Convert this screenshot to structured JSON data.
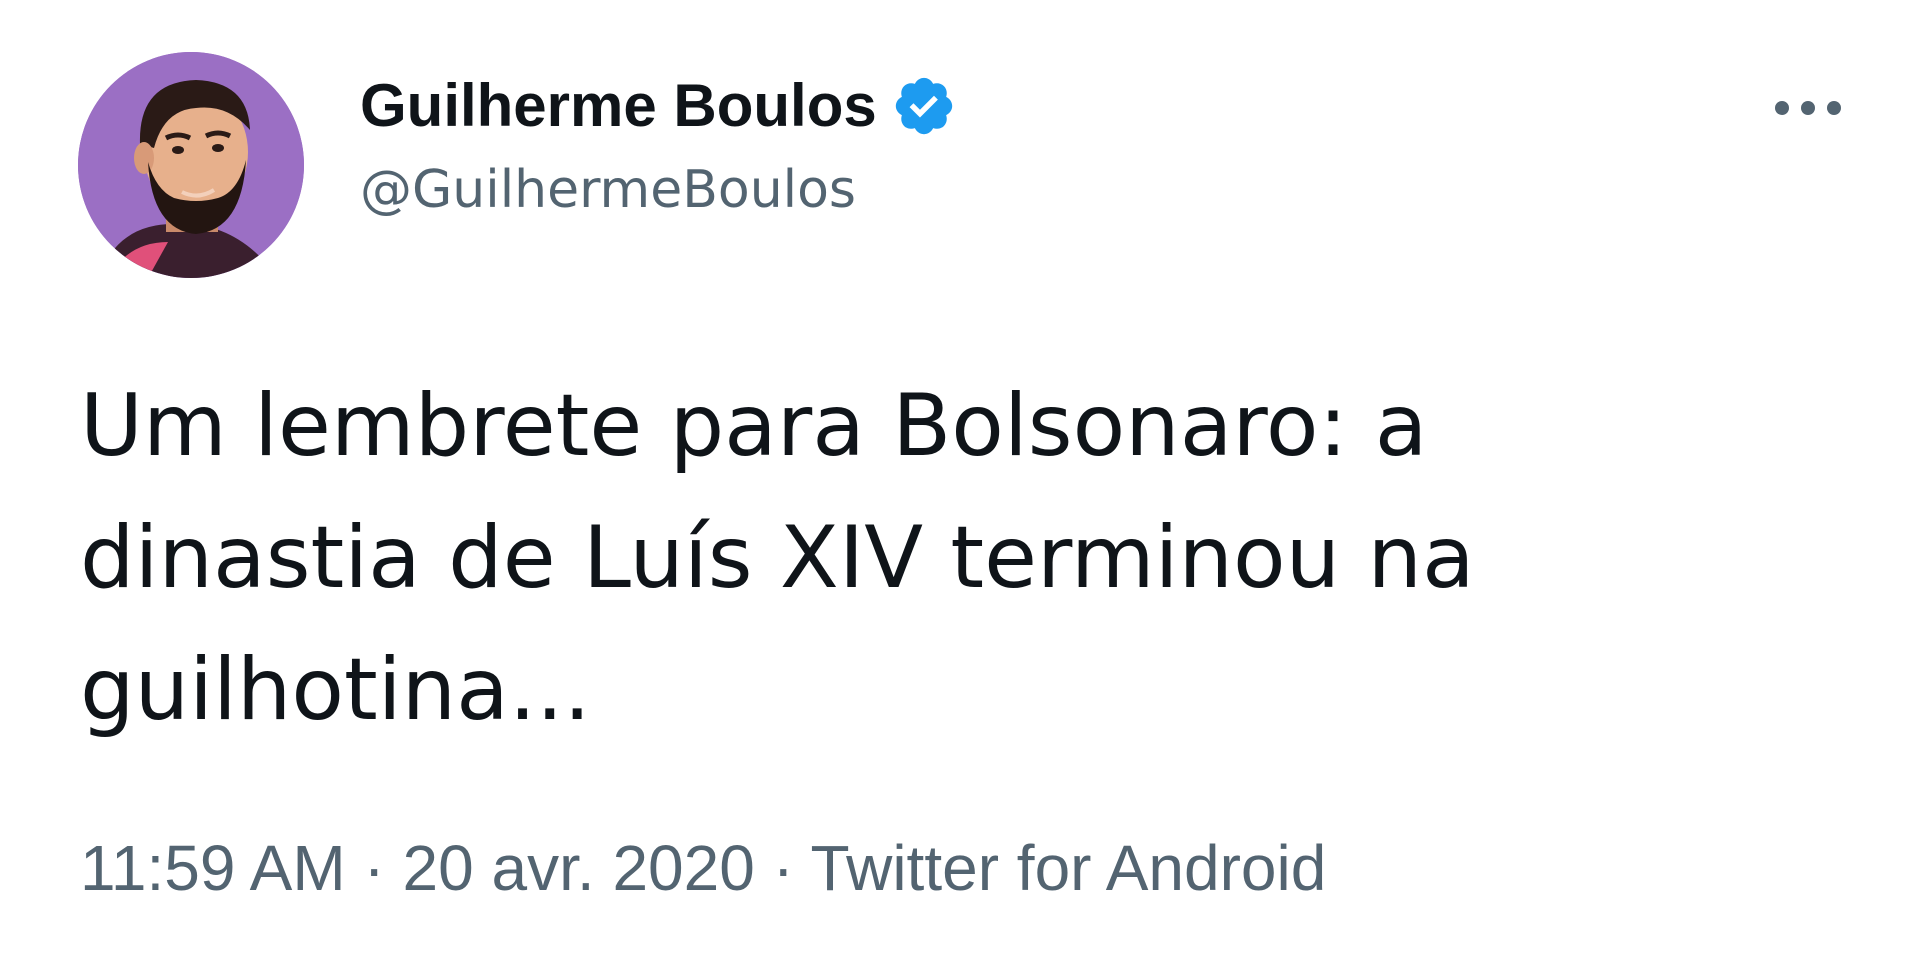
{
  "author": {
    "display_name": "Guilherme Boulos",
    "handle": "@GuilhermeBoulos",
    "verified_icon": "verified-badge-icon",
    "avatar_icon": "avatar-portrait"
  },
  "menu": {
    "more_icon": "more-horizontal-icon"
  },
  "tweet": {
    "text": "Um lembrete para Bolsonaro: a\ndinastia de Luís XIV terminou na\nguilhotina..."
  },
  "meta": {
    "time": "11:59 AM",
    "separator": " · ",
    "date": "20 avr. 2020",
    "source": "Twitter for Android"
  },
  "colors": {
    "text_primary": "#0f1419",
    "text_secondary": "#536471",
    "verified_blue": "#1d9bf0",
    "avatar_bg": "#9b6fc4"
  }
}
